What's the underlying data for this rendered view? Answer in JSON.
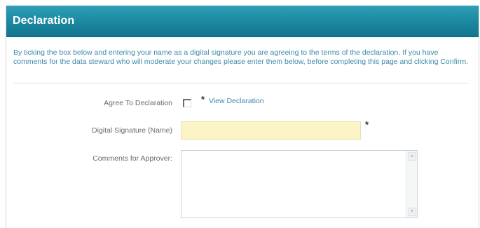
{
  "header": {
    "title": "Declaration"
  },
  "intro": {
    "text": "By ticking the box below and entering your name as a digital signature you are agreeing to the terms of the declaration. If you have comments for the data steward who will moderate your changes please enter them below, before completing this page and clicking Confirm."
  },
  "form": {
    "agree": {
      "label": "Agree To Declaration",
      "checked": false,
      "required_marker": "*",
      "link_text": "View Declaration"
    },
    "signature": {
      "label": "Digital Signature (Name)",
      "value": "",
      "required_marker": "*"
    },
    "comments": {
      "label": "Comments for Approver:",
      "value": ""
    }
  },
  "colors": {
    "header_bg": "#1b87a0",
    "intro_text": "#3d8aa8",
    "signature_field_bg": "#fbf5c6"
  },
  "icons": {
    "scroll_up": "scroll-up-arrow-icon",
    "scroll_down": "scroll-down-arrow-icon"
  }
}
